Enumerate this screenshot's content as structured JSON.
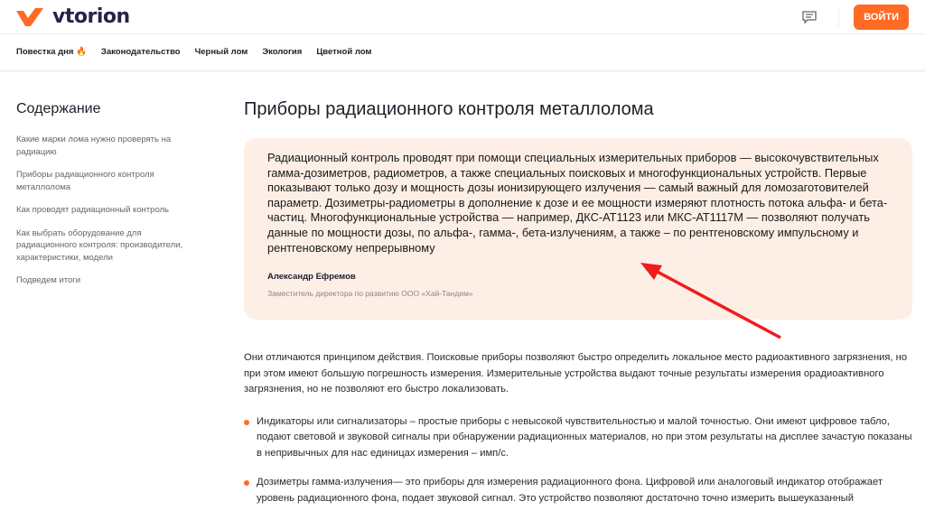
{
  "header": {
    "brand": "vtorion",
    "login_label": "ВОЙТИ",
    "brand_color": "#ff6a24"
  },
  "nav": {
    "items": [
      "Повестка дня",
      "Законодательство",
      "Черный лом",
      "Экология",
      "Цветной лом"
    ]
  },
  "sidebar": {
    "title": "Содержание",
    "items": [
      "Какие марки лома нужно проверять на радиацию",
      "Приборы радиационного контроля металлолома",
      "Как проводят радиационный контроль",
      "Как выбрать оборудование для радиационного контроля: производители, характеристики, модели",
      "Подведем итоги"
    ]
  },
  "main": {
    "title": "Приборы радиационного контроля металлолома",
    "quote": {
      "text": "Радиационный контроль проводят при помощи специальных измерительных приборов — высокочувствительных гамма-дозиметров, радиометров, а также специальных поисковых и многофункциональных устройств. Первые показывают только дозу и мощность дозы ионизирующего излучения — самый важный для ломозаготовителей параметр. Дозиметры-радиометры в дополнение к дозе и ее мощности измеряют плотность потока альфа- и бета-частиц. Многофункциональные устройства — например, ДКС-АТ1123 или МКС-АТ1117М — позволяют получать данные по мощности дозы, по альфа-, гамма-, бета-излучениям, а также – по рентгеновскому импульсному и рентгеновскому непрерывному",
      "author": "Александр Ефремов",
      "role": "Заместитель директора по развитию ООО «Хай-Тандем»"
    },
    "paragraph": "Они отличаются принципом действия. Поисковые приборы позволяют быстро определить локальное место радиоактивного загрязнения, но при этом имеют большую погрешность измерения. Измерительные устройства выдают точные результаты измерения орадиоактивного загрязнения, но не позволяют его быстро локализовать.",
    "bullets": [
      "Индикаторы или сигнализаторы – простые приборы с невысокой чувствительностью и малой точностью. Они имеют цифровое табло, подают световой и звуковой сигналы при обнаружении радиационных материалов, но при этом результаты на дисплее зачастую показаны в непривычных для нас единицах измерения – имп/с.",
      "Дозиметры гамма-излучения— это приборы для измерения радиационного фона. Цифровой или аналоговый индикатор отображает уровень радиационного фона, подает звуковой сигнал. Это устройство позволяют достаточно точно измерить вышеуказанный"
    ]
  },
  "annotation": {
    "arrow_color": "#ee1c1c"
  }
}
